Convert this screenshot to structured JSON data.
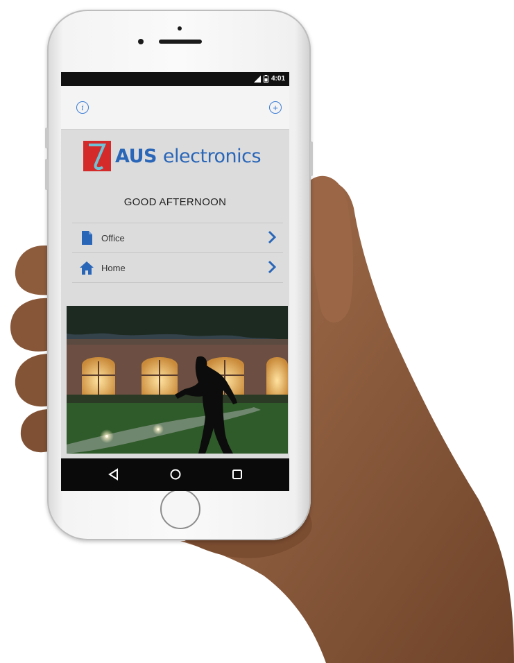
{
  "status_bar": {
    "time": "4:01",
    "icons": [
      "signal-icon",
      "battery-icon"
    ]
  },
  "toolbar": {
    "left_icon": "info-icon",
    "right_icon": "add-circle-icon",
    "accent_color": "#3a7bd5"
  },
  "brand": {
    "logo_bold": "AUS",
    "logo_light": "electronics",
    "brand_color": "#2a66b8",
    "mark_color": "#d42a2a"
  },
  "greeting": "GOOD AFTERNOON",
  "locations": [
    {
      "label": "Office",
      "icon": "document-icon"
    },
    {
      "label": "Home",
      "icon": "house-icon"
    }
  ],
  "nav_bar": {
    "buttons": [
      "back-triangle-icon",
      "home-circle-icon",
      "recents-square-icon"
    ]
  },
  "hero_image": {
    "description_icon": "night-house-photo"
  }
}
